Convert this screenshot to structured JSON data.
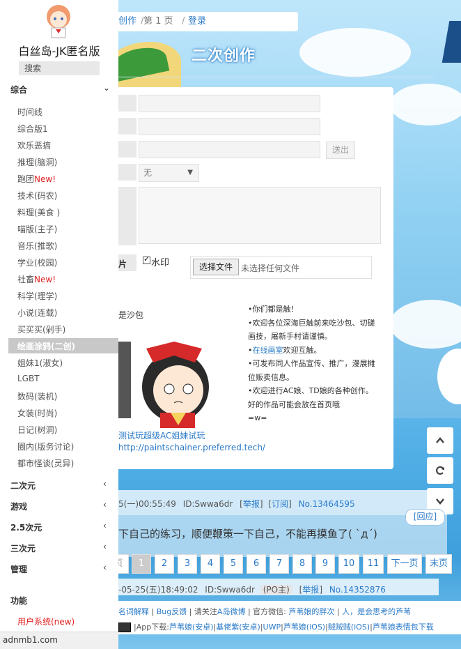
{
  "site": {
    "title": "白丝岛-JK匿名版",
    "search_placeholder": "搜索"
  },
  "sidebar": {
    "cat_main": "综合",
    "items": [
      {
        "label": "时间线",
        "new": ""
      },
      {
        "label": "综合版1",
        "new": ""
      },
      {
        "label": "欢乐恶搞",
        "new": ""
      },
      {
        "label": "推理(脑洞)",
        "new": ""
      },
      {
        "label": "跑团",
        "new": "New!"
      },
      {
        "label": "技术(码农)",
        "new": ""
      },
      {
        "label": "料理(美食     )",
        "new": ""
      },
      {
        "label": "喵版(主子)",
        "new": ""
      },
      {
        "label": "音乐(推歌)",
        "new": ""
      },
      {
        "label": "学业(校园)",
        "new": ""
      },
      {
        "label": "社畜",
        "new": "New!"
      },
      {
        "label": "科学(理学)",
        "new": ""
      },
      {
        "label": "小说(连载)",
        "new": ""
      },
      {
        "label": "买买买(剁手)",
        "new": ""
      }
    ],
    "active_item": "绘画涂鸦(二创)",
    "items2": [
      {
        "label": "姐妹1(淑女)"
      },
      {
        "label": "LGBT"
      },
      {
        "label": "数码(装机)"
      },
      {
        "label": "女装(时尚)"
      },
      {
        "label": "日记(树洞)"
      },
      {
        "label": "圈内(版务讨论)"
      },
      {
        "label": "都市怪谈(灵异)"
      }
    ],
    "categories": [
      "二次元",
      "游戏",
      "2.5次元",
      "三次元",
      "管理"
    ],
    "func_title": "功能",
    "user_system": "用户系统(new)",
    "status_url": "adnmb1.com"
  },
  "breadcrumb": {
    "board": "创作",
    "page": "第 1 页",
    "login": "登录"
  },
  "page_title": "二次创作",
  "form": {
    "send_label": "送出",
    "select_value": "无",
    "image_label": "片",
    "watermark_label": "水印",
    "file_button": "选择文件",
    "file_placeholder": "未选择任何文件"
  },
  "illustration": {
    "caption": "是沙包",
    "link": "测试玩超级AC姐妹试玩",
    "url": "http://paintschainer.preferred.tech/"
  },
  "notice": {
    "line1": "•你们都是触！",
    "line2": "•欢迎各位深海巨触前来吃沙包、切磋画技，屠新手村请谨慎。",
    "line3_link": "在线画室",
    "line3_rest": "欢迎互触。",
    "line4": "•可发布同人作品宣传、推广，漫展摊位贩卖信息。",
    "line5": "•欢迎进行AC娘、TD娘的各种创作。好的作品可能会放在首页哦",
    "line6": "=w="
  },
  "tools": {
    "up": "⌃",
    "refresh": "⟳",
    "down": "⌄"
  },
  "post1": {
    "time": "5(一)00:55:49",
    "id": "ID:Swwa6dr",
    "report": "举报",
    "subscribe": "订阅",
    "no": "No.13464595",
    "reply": "回应",
    "content": "下自己的练习，顺便鞭策一下自己，不能再摸鱼了( `д´)"
  },
  "pager": {
    "prev_partial": "页",
    "pages": [
      "1",
      "2",
      "3",
      "4",
      "5",
      "6",
      "7",
      "8",
      "9",
      "10",
      "11"
    ],
    "next": "下一页",
    "last": "末页"
  },
  "post2": {
    "time": "-05-25(五)18:49:02",
    "id": "ID:Swwa6dr",
    "po": "(PO主)",
    "report": "举报",
    "no": "No.14352876"
  },
  "footer": {
    "l1_a": "名词解释",
    "l1_b": "Bug反馈",
    "l1_c": "请关注",
    "l1_d": "A岛微博",
    "l1_e": "官方微信:",
    "l1_f": "芦苇娘的胖次",
    "l1_g": "人，是会思考的芦苇",
    "l2_a": "|App下载:",
    "l2_b": "芦苇娘(安卓)",
    "l2_c": "基佬紫(安卓)",
    "l2_d": "UWP",
    "l2_e": "芦苇娘(iOS)",
    "l2_f": "贼贼贼(iOS)",
    "l2_g": "芦苇娘表情包下载"
  }
}
